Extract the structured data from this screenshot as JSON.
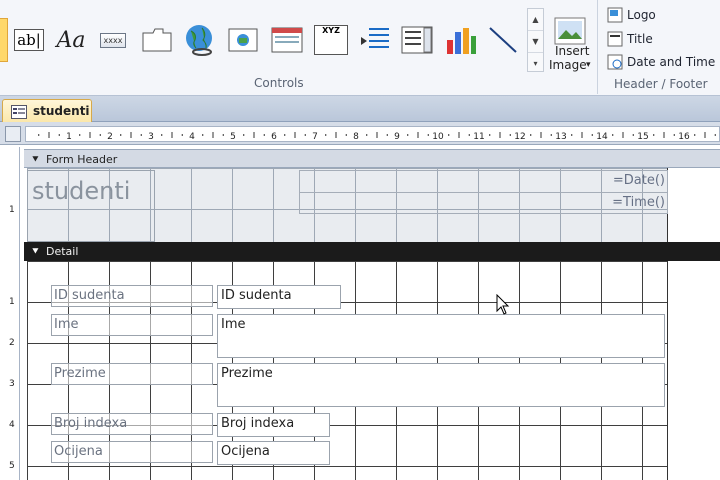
{
  "ribbon": {
    "controls_label": "Controls",
    "header_footer_label": "Header / Footer",
    "textbox_label": "ab|",
    "label_tool": "Aa",
    "button_tool": "xxxx",
    "combo_tool": "XYZ",
    "insert_image_line1": "Insert",
    "insert_image_line2": "Image",
    "logo": "Logo",
    "title": "Title",
    "date_time": "Date and Time"
  },
  "document": {
    "tab_name": "studenti"
  },
  "ruler": {
    "marks": [
      "1",
      "2",
      "3",
      "4",
      "5",
      "6",
      "7",
      "8",
      "9",
      "10",
      "11",
      "12",
      "13",
      "14",
      "15",
      "16"
    ],
    "vmarks": [
      "1",
      "1",
      "2",
      "3",
      "4",
      "5"
    ]
  },
  "form_header": {
    "section_label": "Form Header",
    "title_label": "studenti",
    "date_expr": "=Date()",
    "time_expr": "=Time()"
  },
  "detail": {
    "section_label": "Detail",
    "fields": [
      {
        "label": "ID sudenta",
        "textbox": "ID sudenta"
      },
      {
        "label": "Ime",
        "textbox": "Ime"
      },
      {
        "label": "Prezime",
        "textbox": "Prezime"
      },
      {
        "label": "Broj indexa",
        "textbox": "Broj indexa"
      },
      {
        "label": "Ocijena",
        "textbox": "Ocijena"
      }
    ]
  }
}
